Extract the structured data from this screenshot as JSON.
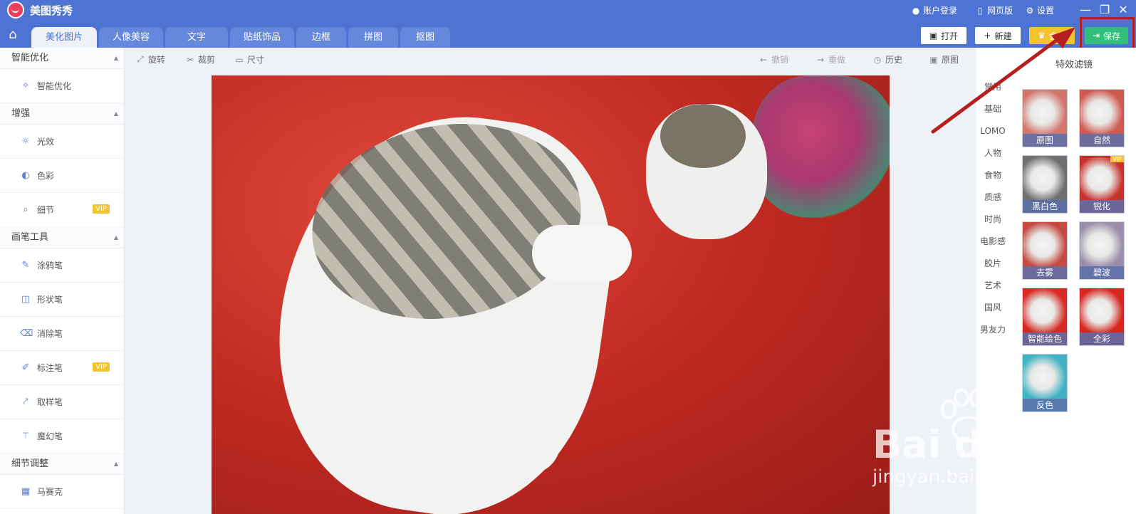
{
  "titlebar": {
    "app_name": "美图秀秀",
    "account": "账户登录",
    "web": "网页版",
    "settings": "设置"
  },
  "tabs": [
    {
      "label": "美化图片",
      "active": true
    },
    {
      "label": "人像美容"
    },
    {
      "label": "文字"
    },
    {
      "label": "贴纸饰品"
    },
    {
      "label": "边框"
    },
    {
      "label": "拼图"
    },
    {
      "label": "抠图"
    }
  ],
  "actions": {
    "open": "打开",
    "new": "新建",
    "vip": "会员",
    "save": "保存"
  },
  "left_panel": {
    "sections": [
      {
        "title": "智能优化",
        "items": [
          {
            "label": "智能优化"
          }
        ]
      },
      {
        "title": "增强",
        "items": [
          {
            "label": "光效"
          },
          {
            "label": "色彩"
          },
          {
            "label": "细节",
            "vip": "VIP"
          }
        ]
      },
      {
        "title": "画笔工具",
        "items": [
          {
            "label": "涂鸦笔"
          },
          {
            "label": "形状笔"
          },
          {
            "label": "消除笔"
          },
          {
            "label": "标注笔",
            "vip": "VIP"
          },
          {
            "label": "取样笔"
          },
          {
            "label": "魔幻笔"
          }
        ]
      },
      {
        "title": "细节调整",
        "items": [
          {
            "label": "马赛克"
          }
        ]
      }
    ]
  },
  "canvas_toolbar": {
    "rotate": "旋转",
    "crop": "裁剪",
    "size": "尺寸",
    "undo": "撤销",
    "redo": "重做",
    "history": "历史",
    "original": "原图"
  },
  "right_panel": {
    "title": "特效滤镜",
    "categories": [
      "常用",
      "基础",
      "LOMO",
      "人物",
      "食物",
      "质感",
      "时尚",
      "电影感",
      "胶片",
      "艺术",
      "国风",
      "男友力"
    ],
    "filters": [
      {
        "label": "原图",
        "tone": "#d2766c"
      },
      {
        "label": "自然",
        "tone": "#cf5a50"
      },
      {
        "label": "黑白色",
        "tone": "#6f6f6f"
      },
      {
        "label": "锐化",
        "tone": "#c8322a",
        "vip": "VIP"
      },
      {
        "label": "去雾",
        "tone": "#c54a42"
      },
      {
        "label": "碧波",
        "tone": "#9a8ea8"
      },
      {
        "label": "智能绘色",
        "tone": "#d62a22"
      },
      {
        "label": "全彩",
        "tone": "#d8261e"
      },
      {
        "label": "反色",
        "tone": "#3fb3c4"
      }
    ]
  },
  "watermark": {
    "brand": "Bai du 经验",
    "url": "jingyan.baidu.com"
  },
  "colors": {
    "brand_blue": "#4d74d3",
    "save_green": "#31c07a",
    "vip_gold": "#f6c330",
    "annotation_red": "#b3201f"
  }
}
